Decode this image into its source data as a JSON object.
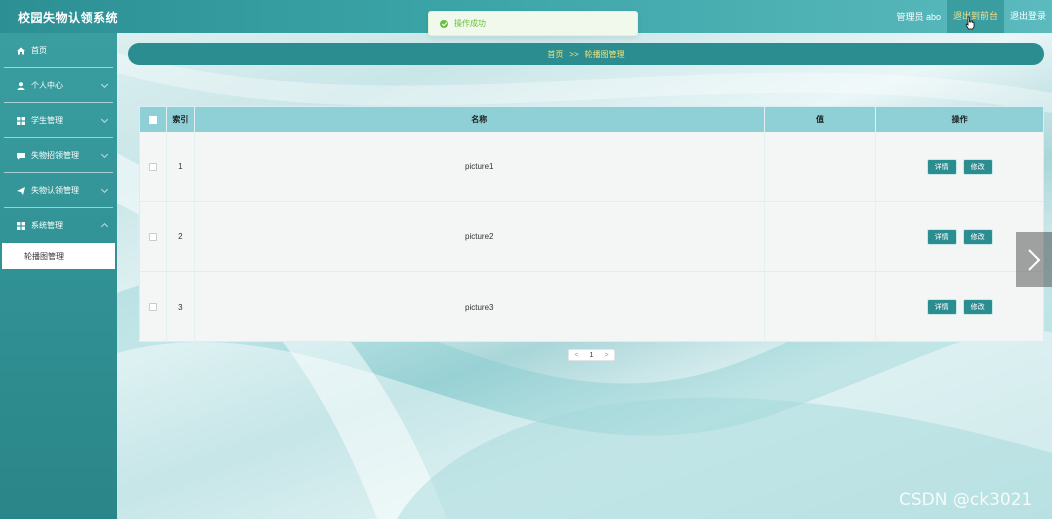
{
  "app": {
    "title": "校园失物认领系统"
  },
  "topbar": {
    "admin_label": "管理员 abo",
    "exit_backend": "退出到前台",
    "logout": "退出登录"
  },
  "toast": {
    "message": "操作成功"
  },
  "sidebar": {
    "items": [
      {
        "label": "首页",
        "icon": "home-icon"
      },
      {
        "label": "个人中心",
        "icon": "user-icon"
      },
      {
        "label": "学生管理",
        "icon": "grid-icon"
      },
      {
        "label": "失物招领管理",
        "icon": "chat-icon"
      },
      {
        "label": "失物认领管理",
        "icon": "send-icon"
      },
      {
        "label": "系统管理",
        "icon": "grid-icon"
      }
    ],
    "sub_item": "轮播图管理"
  },
  "breadcrumb": {
    "home": "首页",
    "sep": ">>",
    "current": "轮播图管理"
  },
  "table": {
    "headers": {
      "index": "索引",
      "name": "名称",
      "value": "值",
      "ops": "操作"
    },
    "rows": [
      {
        "index": "1",
        "name": "picture1",
        "value": ""
      },
      {
        "index": "2",
        "name": "picture2",
        "value": ""
      },
      {
        "index": "3",
        "name": "picture3",
        "value": ""
      }
    ],
    "detail_label": "详情",
    "edit_label": "修改"
  },
  "pagination": {
    "prev": "<",
    "page": "1",
    "next": ">"
  },
  "watermark": "CSDN @ck3021",
  "colors": {
    "primary": "#2b8d90",
    "header": "#8fd0d6",
    "breadcrumb_text": "#f4e37a",
    "success": "#67c23a"
  }
}
